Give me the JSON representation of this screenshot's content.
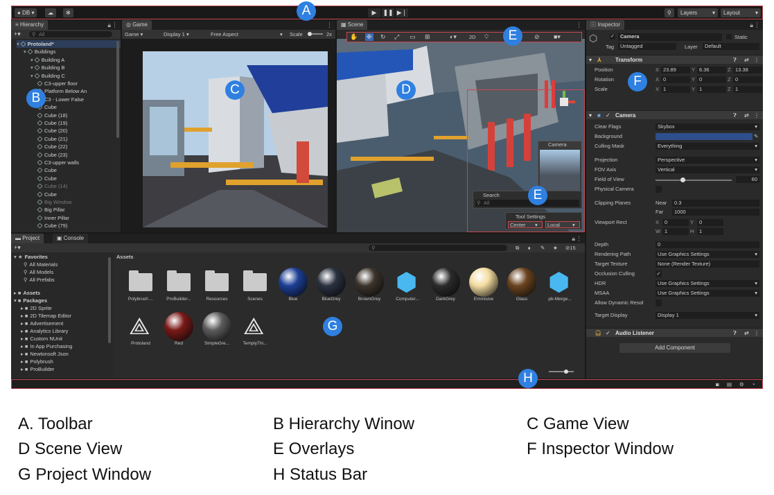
{
  "toolbar": {
    "account": "DB",
    "account_caret": "▾",
    "layers": "Layers",
    "layout": "Layout"
  },
  "hierarchy": {
    "tab": "Hierarchy",
    "search_placeholder": "All",
    "items": [
      {
        "label": "Protoland*",
        "indent": 0,
        "dim": false
      },
      {
        "label": "Buildings",
        "indent": 1,
        "dim": false
      },
      {
        "label": "Building A",
        "indent": 2,
        "dim": false
      },
      {
        "label": "Building B",
        "indent": 2,
        "dim": false
      },
      {
        "label": "Building C",
        "indent": 2,
        "dim": false
      },
      {
        "label": "C3-upper floor",
        "indent": 3,
        "dim": false
      },
      {
        "label": "Platform Below An",
        "indent": 3,
        "dim": false
      },
      {
        "label": "C3 - Lower False",
        "indent": 3,
        "dim": false
      },
      {
        "label": "Cube",
        "indent": 3,
        "dim": false
      },
      {
        "label": "Cube (18)",
        "indent": 3,
        "dim": false
      },
      {
        "label": "Cube (19)",
        "indent": 3,
        "dim": false
      },
      {
        "label": "Cube (20)",
        "indent": 3,
        "dim": false
      },
      {
        "label": "Cube (21)",
        "indent": 3,
        "dim": false
      },
      {
        "label": "Cube (22)",
        "indent": 3,
        "dim": false
      },
      {
        "label": "Cube (23)",
        "indent": 3,
        "dim": false
      },
      {
        "label": "C3-upper walls",
        "indent": 3,
        "dim": false
      },
      {
        "label": "Cube",
        "indent": 3,
        "dim": false
      },
      {
        "label": "Cube",
        "indent": 3,
        "dim": false
      },
      {
        "label": "Cube (14)",
        "indent": 3,
        "dim": true
      },
      {
        "label": "Cube",
        "indent": 3,
        "dim": false
      },
      {
        "label": "Big Window",
        "indent": 3,
        "dim": true
      },
      {
        "label": "Big Pillar",
        "indent": 3,
        "dim": false
      },
      {
        "label": "Inner Pillar",
        "indent": 3,
        "dim": false
      },
      {
        "label": "Cube (79)",
        "indent": 3,
        "dim": false
      }
    ]
  },
  "game": {
    "tab": "Game",
    "mode": "Game",
    "display": "Display 1",
    "aspect": "Free Aspect",
    "scale_label": "Scale",
    "scale_value": "2x"
  },
  "scene": {
    "tab": "Scene",
    "toggle_2d": "2D",
    "camera_overlay": "Camera",
    "search_overlay": "Search",
    "search_placeholder": "All",
    "tool_settings": "Tool Settings",
    "pivot_center": "Center",
    "pivot_local": "Local"
  },
  "inspector": {
    "tab": "Inspector",
    "object_name": "Camera",
    "static_label": "Static",
    "tag_label": "Tag",
    "tag_value": "Untagged",
    "layer_label": "Layer",
    "layer_value": "Default",
    "transform": {
      "title": "Transform",
      "rows": [
        {
          "label": "Position",
          "x": "23.89",
          "y": "6.36",
          "z": "13.38"
        },
        {
          "label": "Rotation",
          "x": "0",
          "y": "0",
          "z": "0"
        },
        {
          "label": "Scale",
          "x": "1",
          "y": "1",
          "z": "1"
        }
      ]
    },
    "camera": {
      "title": "Camera",
      "clear_flags": {
        "label": "Clear Flags",
        "value": "Skybox"
      },
      "background": {
        "label": "Background"
      },
      "culling_mask": {
        "label": "Culling Mask",
        "value": "Everything"
      },
      "projection": {
        "label": "Projection",
        "value": "Perspective"
      },
      "fov_axis": {
        "label": "FOV Axis",
        "value": "Vertical"
      },
      "field_of_view": {
        "label": "Field of View",
        "value": "60"
      },
      "physical_camera": {
        "label": "Physical Camera"
      },
      "clipping_planes": {
        "label": "Clipping Planes",
        "near_label": "Near",
        "near": "0.3",
        "far_label": "Far",
        "far": "1000"
      },
      "viewport_rect": {
        "label": "Viewport Rect",
        "x": "0",
        "y": "0",
        "w": "1",
        "h": "1"
      },
      "depth": {
        "label": "Depth",
        "value": "0"
      },
      "rendering_path": {
        "label": "Rendering Path",
        "value": "Use Graphics Settings"
      },
      "target_texture": {
        "label": "Target Texture",
        "value": "None (Render Texture)"
      },
      "occlusion_culling": {
        "label": "Occlusion Culling"
      },
      "hdr": {
        "label": "HDR",
        "value": "Use Graphics Settings"
      },
      "msaa": {
        "label": "MSAA",
        "value": "Use Graphics Settings"
      },
      "allow_dynamic": {
        "label": "Allow Dynamic Resol"
      },
      "target_display": {
        "label": "Target Display",
        "value": "Display 1"
      }
    },
    "audio_listener": "Audio Listener",
    "add_component": "Add Component"
  },
  "project": {
    "tab_project": "Project",
    "tab_console": "Console",
    "count": "15",
    "favorites": {
      "title": "Favorites",
      "items": [
        "All Materials",
        "All Models",
        "All Prefabs"
      ]
    },
    "assets_title": "Assets",
    "packages_title": "Packages",
    "packages": [
      "2D Sprite",
      "2D Tilemap Editor",
      "Advertisement",
      "Analytics Library",
      "Custom NUnit",
      "In App Purchasing",
      "Newtonsoft Json",
      "Polybrush",
      "ProBuilder"
    ],
    "breadcrumb": "Assets",
    "assets_row1": [
      {
        "label": "Polybrush ...",
        "kind": "folder"
      },
      {
        "label": "ProBuilder...",
        "kind": "folder"
      },
      {
        "label": "Resources",
        "kind": "folder"
      },
      {
        "label": "Scenes",
        "kind": "folder"
      },
      {
        "label": "Blue",
        "kind": "sphere",
        "color": "#1c3f95"
      },
      {
        "label": "BlueGrey",
        "kind": "sphere",
        "color": "#2a3140"
      },
      {
        "label": "BrownGrey",
        "kind": "sphere",
        "color": "#3c342c"
      },
      {
        "label": "Computer...",
        "kind": "cube"
      },
      {
        "label": "DarkGrey",
        "kind": "sphere",
        "color": "#2b2b2b"
      },
      {
        "label": "Emmisive",
        "kind": "sphere",
        "color": "#f3dca0"
      },
      {
        "label": "Glass",
        "kind": "sphere",
        "color": "#6a4420"
      },
      {
        "label": "pb-Merge...",
        "kind": "cube"
      }
    ],
    "assets_row2": [
      {
        "label": "Protoland",
        "kind": "unity"
      },
      {
        "label": "Red",
        "kind": "sphere",
        "color": "#7a1a17"
      },
      {
        "label": "SimpleGre...",
        "kind": "sphere",
        "color": "#5c5c5c"
      },
      {
        "label": "TemplyThi...",
        "kind": "unity"
      }
    ]
  },
  "callouts": [
    "A",
    "B",
    "C",
    "D",
    "E",
    "E",
    "F",
    "G",
    "H"
  ],
  "legend": [
    "A. Toolbar",
    "B Hierarchy Winow",
    "C Game View",
    "D Scene View",
    "E Overlays",
    "F Inspector Window",
    "G Project Window",
    "H Status Bar"
  ],
  "colors": {
    "callout": "#2f80e0",
    "highlight": "#c8474e",
    "editor_bg": "#191919",
    "panel_bg": "#282828"
  }
}
